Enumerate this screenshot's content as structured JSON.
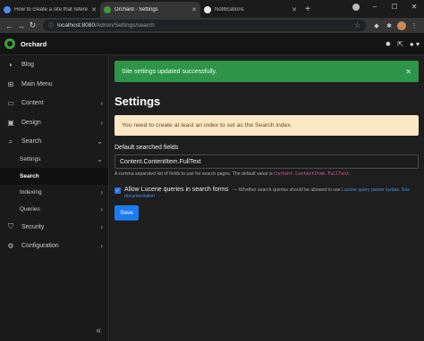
{
  "browser": {
    "tabs": [
      {
        "title": "How to create a site that refere",
        "active": false,
        "favicon_color": "#4c8bf5"
      },
      {
        "title": "Orchard - Settings",
        "active": true,
        "favicon_color": "#3d9b3a"
      },
      {
        "title": "Notifications",
        "active": false,
        "favicon_color": "#e8e8e8"
      }
    ],
    "new_tab": "+",
    "address": {
      "host": "localhost:8080",
      "path": "/Admin/Settings/search"
    }
  },
  "app": {
    "brand": "Orchard"
  },
  "sidebar": {
    "items": [
      {
        "label": "Blog",
        "icon": "rss-icon"
      },
      {
        "label": "Main Menu",
        "icon": "sitemap-icon"
      },
      {
        "label": "Content",
        "icon": "inbox-icon"
      },
      {
        "label": "Design",
        "icon": "monitor-icon"
      },
      {
        "label": "Search",
        "icon": "search-icon"
      },
      {
        "label": "Settings"
      },
      {
        "label": "Search"
      },
      {
        "label": "Indexing"
      },
      {
        "label": "Queries"
      },
      {
        "label": "Security",
        "icon": "shield-icon"
      },
      {
        "label": "Configuration",
        "icon": "gear-icon"
      }
    ]
  },
  "main": {
    "success_message": "Site settings updated successfully.",
    "title": "Settings",
    "warning_message": "You need to create at least an index to set as the Search index.",
    "fields_label": "Default searched fields",
    "fields_value": "Content.ContentItem.FullText",
    "hint_text": "A comma separated list of fields to use for search pages. The default value is",
    "hint_code": "Content.ContentItem.FullText",
    "hint_end": ".",
    "lucene_label": "Allow Lucene queries in search forms",
    "lucene_desc": "— Whether search queries should be allowed to use",
    "lucene_link1": "Lucene query parser syntax",
    "lucene_link2": "See documentation",
    "save_label": "Save"
  },
  "colors": {
    "success": "#2e9447",
    "warning": "#fde8c5",
    "primary": "#1b7bf0",
    "brand": "#3d9b3a"
  }
}
